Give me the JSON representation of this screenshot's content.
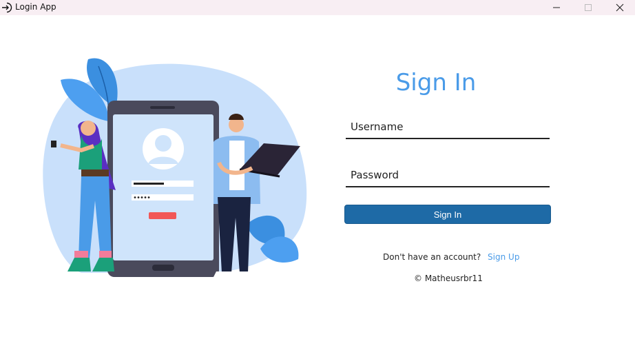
{
  "window": {
    "title": "Login App",
    "icon": "login-arrow-icon",
    "controls": [
      "minimize-icon",
      "maximize-icon",
      "close-icon"
    ]
  },
  "form": {
    "heading": "Sign In",
    "username_placeholder": "Username",
    "password_placeholder": "Password",
    "submit_label": "Sign In",
    "signup_prompt": "Don't have an account?",
    "signup_link": "Sign Up",
    "copyright": "© Matheusrbr11"
  },
  "colors": {
    "accent": "#4a9be8",
    "button": "#1e6aa6",
    "titlebar": "#f8eef3"
  }
}
